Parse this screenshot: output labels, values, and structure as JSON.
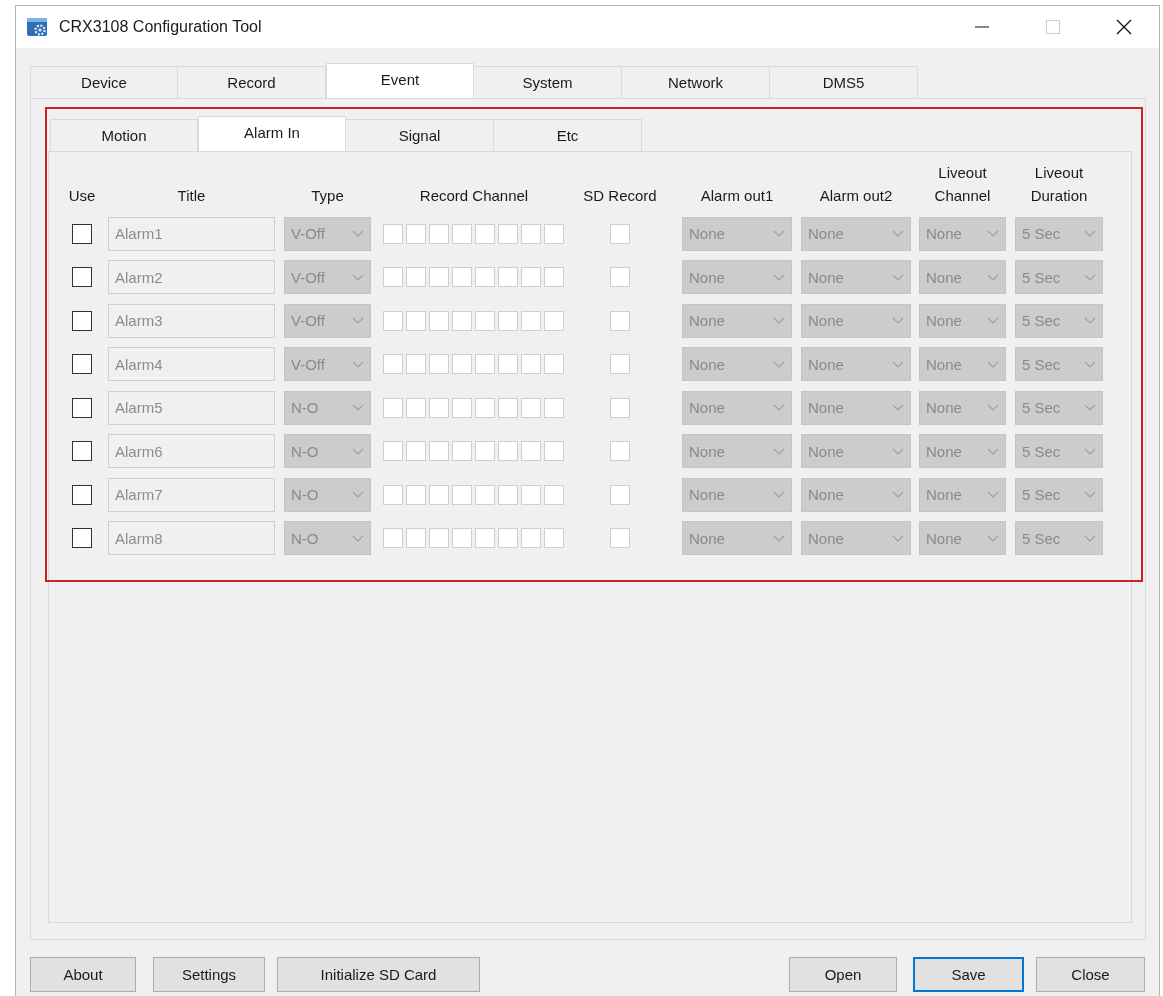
{
  "window": {
    "title": "CRX3108 Configuration Tool",
    "maximize_disabled": true
  },
  "tabs": [
    {
      "label": "Device",
      "selected": false
    },
    {
      "label": "Record",
      "selected": false
    },
    {
      "label": "Event",
      "selected": true
    },
    {
      "label": "System",
      "selected": false
    },
    {
      "label": "Network",
      "selected": false
    },
    {
      "label": "DMS5",
      "selected": false
    }
  ],
  "event_panel": {
    "highlighted": true,
    "tabs": [
      {
        "label": "Motion",
        "selected": false
      },
      {
        "label": "Alarm In",
        "selected": true
      },
      {
        "label": "Signal",
        "selected": false
      },
      {
        "label": "Etc",
        "selected": false
      }
    ],
    "columns": [
      "Use",
      "Title",
      "Type",
      "Record Channel",
      "SD Record",
      "Alarm out1",
      "Alarm out2",
      "Liveout Channel",
      "Liveout Duration"
    ],
    "rows": [
      {
        "use": false,
        "title": "Alarm1",
        "type": "V-Off",
        "record_channels": [
          false,
          false,
          false,
          false,
          false,
          false,
          false,
          false
        ],
        "sd_record": false,
        "alarm_out1": "None",
        "alarm_out2": "None",
        "liveout_channel": "None",
        "liveout_duration": "5 Sec",
        "disabled": true
      },
      {
        "use": false,
        "title": "Alarm2",
        "type": "V-Off",
        "record_channels": [
          false,
          false,
          false,
          false,
          false,
          false,
          false,
          false
        ],
        "sd_record": false,
        "alarm_out1": "None",
        "alarm_out2": "None",
        "liveout_channel": "None",
        "liveout_duration": "5 Sec",
        "disabled": true
      },
      {
        "use": false,
        "title": "Alarm3",
        "type": "V-Off",
        "record_channels": [
          false,
          false,
          false,
          false,
          false,
          false,
          false,
          false
        ],
        "sd_record": false,
        "alarm_out1": "None",
        "alarm_out2": "None",
        "liveout_channel": "None",
        "liveout_duration": "5 Sec",
        "disabled": true
      },
      {
        "use": false,
        "title": "Alarm4",
        "type": "V-Off",
        "record_channels": [
          false,
          false,
          false,
          false,
          false,
          false,
          false,
          false
        ],
        "sd_record": false,
        "alarm_out1": "None",
        "alarm_out2": "None",
        "liveout_channel": "None",
        "liveout_duration": "5 Sec",
        "disabled": true
      },
      {
        "use": false,
        "title": "Alarm5",
        "type": "N-O",
        "record_channels": [
          false,
          false,
          false,
          false,
          false,
          false,
          false,
          false
        ],
        "sd_record": false,
        "alarm_out1": "None",
        "alarm_out2": "None",
        "liveout_channel": "None",
        "liveout_duration": "5 Sec",
        "disabled": true
      },
      {
        "use": false,
        "title": "Alarm6",
        "type": "N-O",
        "record_channels": [
          false,
          false,
          false,
          false,
          false,
          false,
          false,
          false
        ],
        "sd_record": false,
        "alarm_out1": "None",
        "alarm_out2": "None",
        "liveout_channel": "None",
        "liveout_duration": "5 Sec",
        "disabled": true
      },
      {
        "use": false,
        "title": "Alarm7",
        "type": "N-O",
        "record_channels": [
          false,
          false,
          false,
          false,
          false,
          false,
          false,
          false
        ],
        "sd_record": false,
        "alarm_out1": "None",
        "alarm_out2": "None",
        "liveout_channel": "None",
        "liveout_duration": "5 Sec",
        "disabled": true
      },
      {
        "use": false,
        "title": "Alarm8",
        "type": "N-O",
        "record_channels": [
          false,
          false,
          false,
          false,
          false,
          false,
          false,
          false
        ],
        "sd_record": false,
        "alarm_out1": "None",
        "alarm_out2": "None",
        "liveout_channel": "None",
        "liveout_duration": "5 Sec",
        "disabled": true
      }
    ]
  },
  "buttons_left": [
    {
      "label": "About",
      "focused": false
    },
    {
      "label": "Settings",
      "focused": false
    },
    {
      "label": "Initialize SD Card",
      "focused": false
    }
  ],
  "buttons_right": [
    {
      "label": "Open",
      "focused": false
    },
    {
      "label": "Save",
      "focused": true
    },
    {
      "label": "Close",
      "focused": false
    }
  ]
}
